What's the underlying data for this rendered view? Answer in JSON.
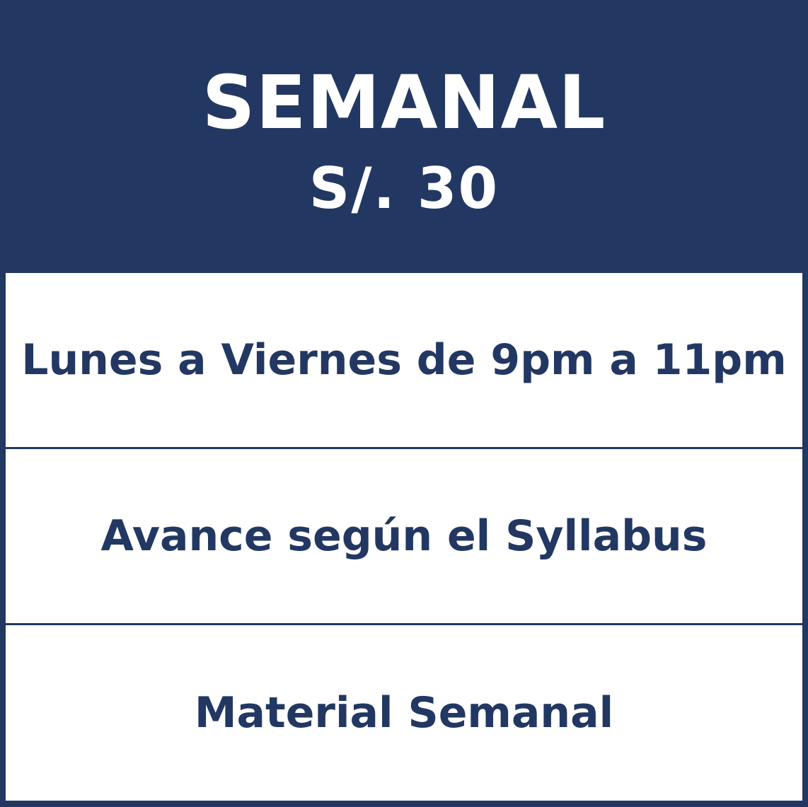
{
  "plan": {
    "name": "SEMANAL",
    "price": "S/. 30"
  },
  "features": [
    {
      "label": "Lunes a Viernes de 9pm a 11pm"
    },
    {
      "label": "Avance según el Syllabus"
    },
    {
      "label": "Material Semanal"
    }
  ],
  "colors": {
    "primary": "#223862",
    "background": "#ffffff",
    "header_text": "#ffffff"
  }
}
